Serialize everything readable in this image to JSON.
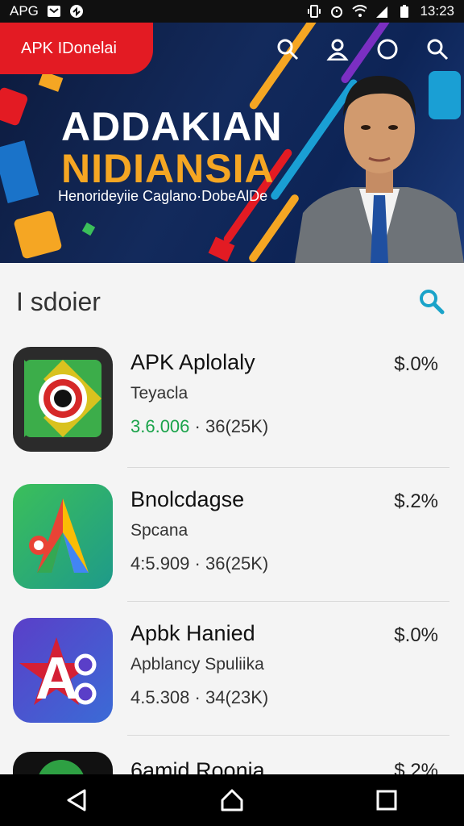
{
  "status_bar": {
    "carrier": "APG",
    "time": "13:23"
  },
  "banner": {
    "brand": "APK IDonelai",
    "headline1": "ADDAKIAN",
    "headline2": "NIDIANSIA",
    "subline": "Henorideyiie Caglano·DobeAlDe"
  },
  "search": {
    "placeholder": "I sdoier"
  },
  "apps": [
    {
      "name": "APK Aplolaly",
      "developer": "Teyacla",
      "version": "3.6.006",
      "size": "36(25K)",
      "price": "$.0%"
    },
    {
      "name": "Bnolcdagse",
      "developer": "Spcana",
      "version": "4:5.909",
      "size": "36(25K)",
      "price": "$.2%"
    },
    {
      "name": "Apbk Hanied",
      "developer": "Apblancy Spuliika",
      "version": "4.5.308",
      "size": "34(23K)",
      "price": "$.0%"
    },
    {
      "name": "6amid Roonia",
      "developer": "",
      "version": "",
      "size": "",
      "price": "$.2%"
    }
  ],
  "meta_separator": "·",
  "colors": {
    "brand_red": "#e31b23",
    "accent_orange": "#f5a623",
    "version_green": "#1aa34a",
    "search_teal": "#1aa3c9"
  }
}
